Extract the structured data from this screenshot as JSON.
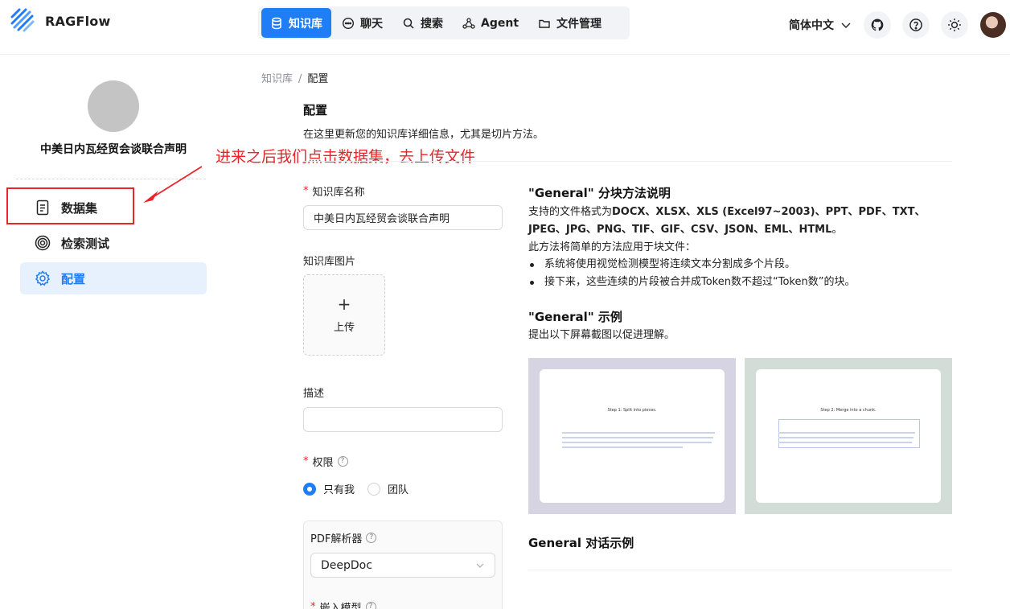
{
  "app": {
    "name": "RAGFlow"
  },
  "nav": [
    {
      "label": "知识库",
      "icon": "database-icon",
      "active": true
    },
    {
      "label": "聊天",
      "icon": "chat-icon",
      "active": false
    },
    {
      "label": "搜索",
      "icon": "search-icon",
      "active": false
    },
    {
      "label": "Agent",
      "icon": "agent-icon",
      "active": false
    },
    {
      "label": "文件管理",
      "icon": "folder-icon",
      "active": false
    }
  ],
  "header": {
    "language": "简体中文"
  },
  "sidebar": {
    "kb_name": "中美日内瓦经贸会谈联合声明",
    "items": [
      {
        "label": "数据集",
        "icon": "document-icon"
      },
      {
        "label": "检索测试",
        "icon": "target-icon"
      },
      {
        "label": "配置",
        "icon": "gear-icon",
        "active": true
      }
    ]
  },
  "annotation": {
    "text": "进来之后我们点击数据集，去上传文件"
  },
  "breadcrumb": {
    "root": "知识库",
    "sep": "/",
    "current": "配置"
  },
  "page": {
    "title": "配置",
    "description": "在这里更新您的知识库详细信息，尤其是切片方法。"
  },
  "form": {
    "name_label": "知识库名称",
    "name_value": "中美日内瓦经贸会谈联合声明",
    "image_label": "知识库图片",
    "upload_label": "上传",
    "upload_plus": "+",
    "desc_label": "描述",
    "desc_value": "",
    "perm_label": "权限",
    "perm_options": [
      "只有我",
      "团队"
    ],
    "perm_selected": "只有我",
    "parser_label": "PDF解析器",
    "parser_value": "DeepDoc",
    "embed_label": "嵌入模型",
    "req": "*",
    "help": "?"
  },
  "info": {
    "title": "\"General\" 分块方法说明",
    "formats_prefix": "支持的文件格式为",
    "formats": "DOCX、XLSX、XLS (Excel97~2003)、PPT、PDF、TXT、JPEG、JPG、PNG、TIF、GIF、CSV、JSON、EML、HTML",
    "formats_suffix": "。",
    "method": "此方法将简单的方法应用于块文件：",
    "bullets": [
      "系统将使用视觉检测模型将连续文本分割成多个片段。",
      "接下来，这些连续的片段被合并成Token数不超过“Token数”的块。"
    ],
    "example_title": "\"General\" 示例",
    "example_desc": "提出以下屏幕截图以促进理解。",
    "shot1_step": "Step 1: Split into pieces.",
    "shot2_step": "Step 2: Merge into a chunk.",
    "shot1_bg": "#d6d3e3",
    "shot2_bg": "#d3ddd8",
    "dialog_title": "General 对话示例"
  },
  "colors": {
    "accent": "#1f7ef6",
    "annotation": "#e8252a"
  }
}
